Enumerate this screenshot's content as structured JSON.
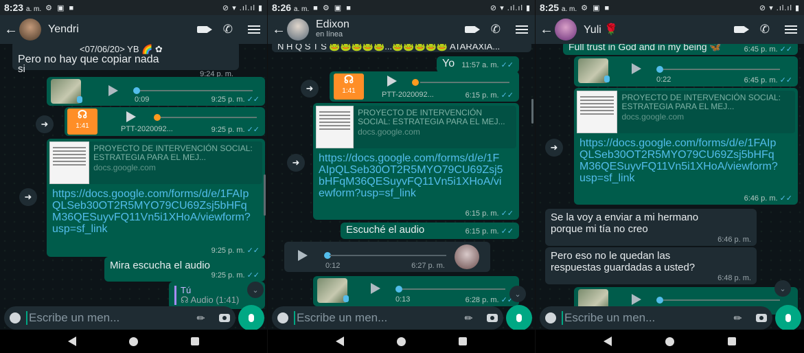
{
  "screens": [
    {
      "time": "8:23",
      "ampm": "a. m.",
      "contact": "Yendri",
      "subtitle": "",
      "input_placeholder": "Escribe un men...",
      "msgs": {
        "m1": "<07/06/20> YB 🌈 ✿",
        "m2": "Pero no hay que copiar nada",
        "m3": "si",
        "m3_time": "9:24 p. m.",
        "v1_dur": "0:09",
        "v1_time": "9:25 p. m.",
        "a_len": "1:41",
        "a_name": "PTT-2020092...",
        "a_time": "9:25 p. m.",
        "p_title": "PROYECTO DE INTERVENCIÓN SOCIAL: ESTRATEGIA PARA EL MEJ...",
        "p_domain": "docs.google.com",
        "link": "https://docs.google.com/forms/d/e/1FAIpQLSeb30OT2R5MYO79CU69Zsj5bHFqM36QESuyvFQ11Vn5i1XHoA/viewform?usp=sf_link",
        "link_time": "9:25 p. m.",
        "m4": "Mira escucha el audio",
        "m4_time": "9:25 p. m.",
        "q_name": "Tú",
        "q_text": "Audio (1:41)"
      }
    },
    {
      "time": "8:26",
      "ampm": "a. m.",
      "contact": "Edixon",
      "subtitle": "en línea",
      "input_placeholder": "Escribe un men...",
      "msgs": {
        "top": "N H Q S T S 🐸🐸🐸🐸🐸...🐸🐸🐸🐸🐸 ATARAXIA...",
        "yo": "Yo",
        "yo_time": "11:57 a. m.",
        "a_len": "1:41",
        "a_name": "PTT-2020092...",
        "a_time": "6:15 p. m.",
        "p_title": "PROYECTO DE INTERVENCIÓN SOCIAL: ESTRATEGIA PARA EL MEJ...",
        "p_domain": "docs.google.com",
        "link": "https://docs.google.com/forms/d/e/1FAIpQLSeb30OT2R5MYO79CU69Zsj5bHFqM36QESuyvFQ11Vn5i1XHoA/viewform?usp=sf_link",
        "link_time": "6:15 p. m.",
        "esc": "Escuché el audio",
        "esc_time": "6:15 p. m.",
        "v_in_dur": "0:12",
        "v_in_time": "6:27 p. m.",
        "v_out_dur": "0:13",
        "v_out_time": "6:28 p. m."
      }
    },
    {
      "time": "8:25",
      "ampm": "a. m.",
      "contact": "Yuli 🌹",
      "subtitle": "",
      "input_placeholder": "Escribe un men...",
      "msgs": {
        "top": "Full trust in God and in my being 🦋",
        "top_time": "6:45 p. m.",
        "v_dur": "0:22",
        "v_time": "6:45 p. m.",
        "p_title": "PROYECTO DE INTERVENCIÓN SOCIAL: ESTRATEGIA PARA EL MEJ...",
        "p_domain": "docs.google.com",
        "link": "https://docs.google.com/forms/d/e/1FAIpQLSeb30OT2R5MYO79CU69Zsj5bHFqM36QESuyvFQ11Vn5i1XHoA/viewform?usp=sf_link",
        "link_time": "6:46 p. m.",
        "r1": "Se la voy a enviar a mi hermano porque mi tía no creo",
        "r1_time": "6:46 p. m.",
        "r2": "Pero eso no le quedan las respuestas guardadas a usted?",
        "r2_time": "6:48 p. m."
      }
    }
  ],
  "colors": {
    "bg": "#0d1418",
    "header": "#1f2c33",
    "outgoing": "#005c4b",
    "incoming": "#1f2c33",
    "accent": "#00a884",
    "link": "#53bdeb"
  },
  "icons": [
    "back-arrow-icon",
    "video-call-icon",
    "phone-icon",
    "menu-icon",
    "forward-icon",
    "play-icon",
    "headphones-icon",
    "mic-icon",
    "emoji-icon",
    "attach-icon",
    "camera-icon",
    "scroll-down-icon"
  ]
}
